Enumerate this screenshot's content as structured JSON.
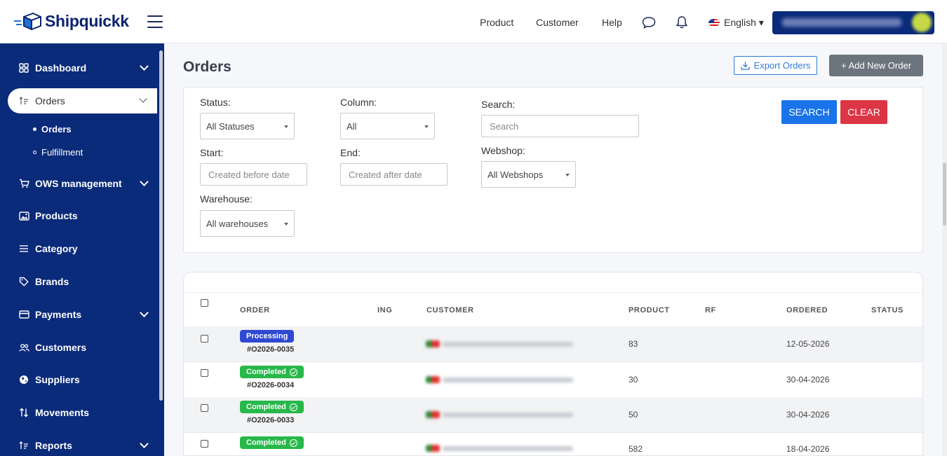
{
  "brand": {
    "name": "Shipquickk"
  },
  "topnav": {
    "product": "Product",
    "customer": "Customer",
    "help": "Help",
    "language": "English ▾"
  },
  "sidebar": {
    "items": [
      {
        "label": "Dashboard",
        "icon": "grid-icon"
      },
      {
        "label": "Orders",
        "icon": "sort-icon"
      },
      {
        "label": "OWS management",
        "icon": "cart-icon"
      },
      {
        "label": "Products",
        "icon": "image-icon"
      },
      {
        "label": "Category",
        "icon": "list-icon"
      },
      {
        "label": "Brands",
        "icon": "tag-icon"
      },
      {
        "label": "Payments",
        "icon": "card-icon"
      },
      {
        "label": "Customers",
        "icon": "users-icon"
      },
      {
        "label": "Suppliers",
        "icon": "globe-icon"
      },
      {
        "label": "Movements",
        "icon": "arrows-icon"
      },
      {
        "label": "Reports",
        "icon": "sort-icon"
      }
    ],
    "sub": [
      {
        "label": "Orders"
      },
      {
        "label": "Fulfillment"
      }
    ]
  },
  "page": {
    "title": "Orders",
    "export_label": "Export Orders",
    "add_label": "+ Add New Order"
  },
  "filters": {
    "status_label": "Status:",
    "status_value": "All Statuses",
    "column_label": "Column:",
    "column_value": "All",
    "search_label": "Search:",
    "search_placeholder": "Search",
    "start_label": "Start:",
    "start_placeholder": "Created before date",
    "end_label": "End:",
    "end_placeholder": "Created after date",
    "webshop_label": "Webshop:",
    "webshop_value": "All Webshops",
    "warehouse_label": "Warehouse:",
    "warehouse_value": "All warehouses",
    "search_button": "SEARCH",
    "clear_button": "CLEAR"
  },
  "table": {
    "headers": [
      "ORDER",
      "ING",
      "CUSTOMER",
      "PRODUCT",
      "RF",
      "ORDERED",
      "STATUS"
    ],
    "rows": [
      {
        "status": "Processing",
        "order": "#O2026-0035",
        "product": "83",
        "ordered": "12-05-2026"
      },
      {
        "status": "Completed",
        "order": "#O2026-0034",
        "product": "30",
        "ordered": "30-04-2026"
      },
      {
        "status": "Completed",
        "order": "#O2026-0033",
        "product": "50",
        "ordered": "30-04-2026"
      },
      {
        "status": "Completed",
        "order": "",
        "product": "582",
        "ordered": "18-04-2026"
      }
    ]
  },
  "colors": {
    "sidebar": "#0a2a7a",
    "primary": "#1a73e8",
    "danger": "#dc3545",
    "processing": "#2f49d1",
    "completed": "#28b84a"
  }
}
